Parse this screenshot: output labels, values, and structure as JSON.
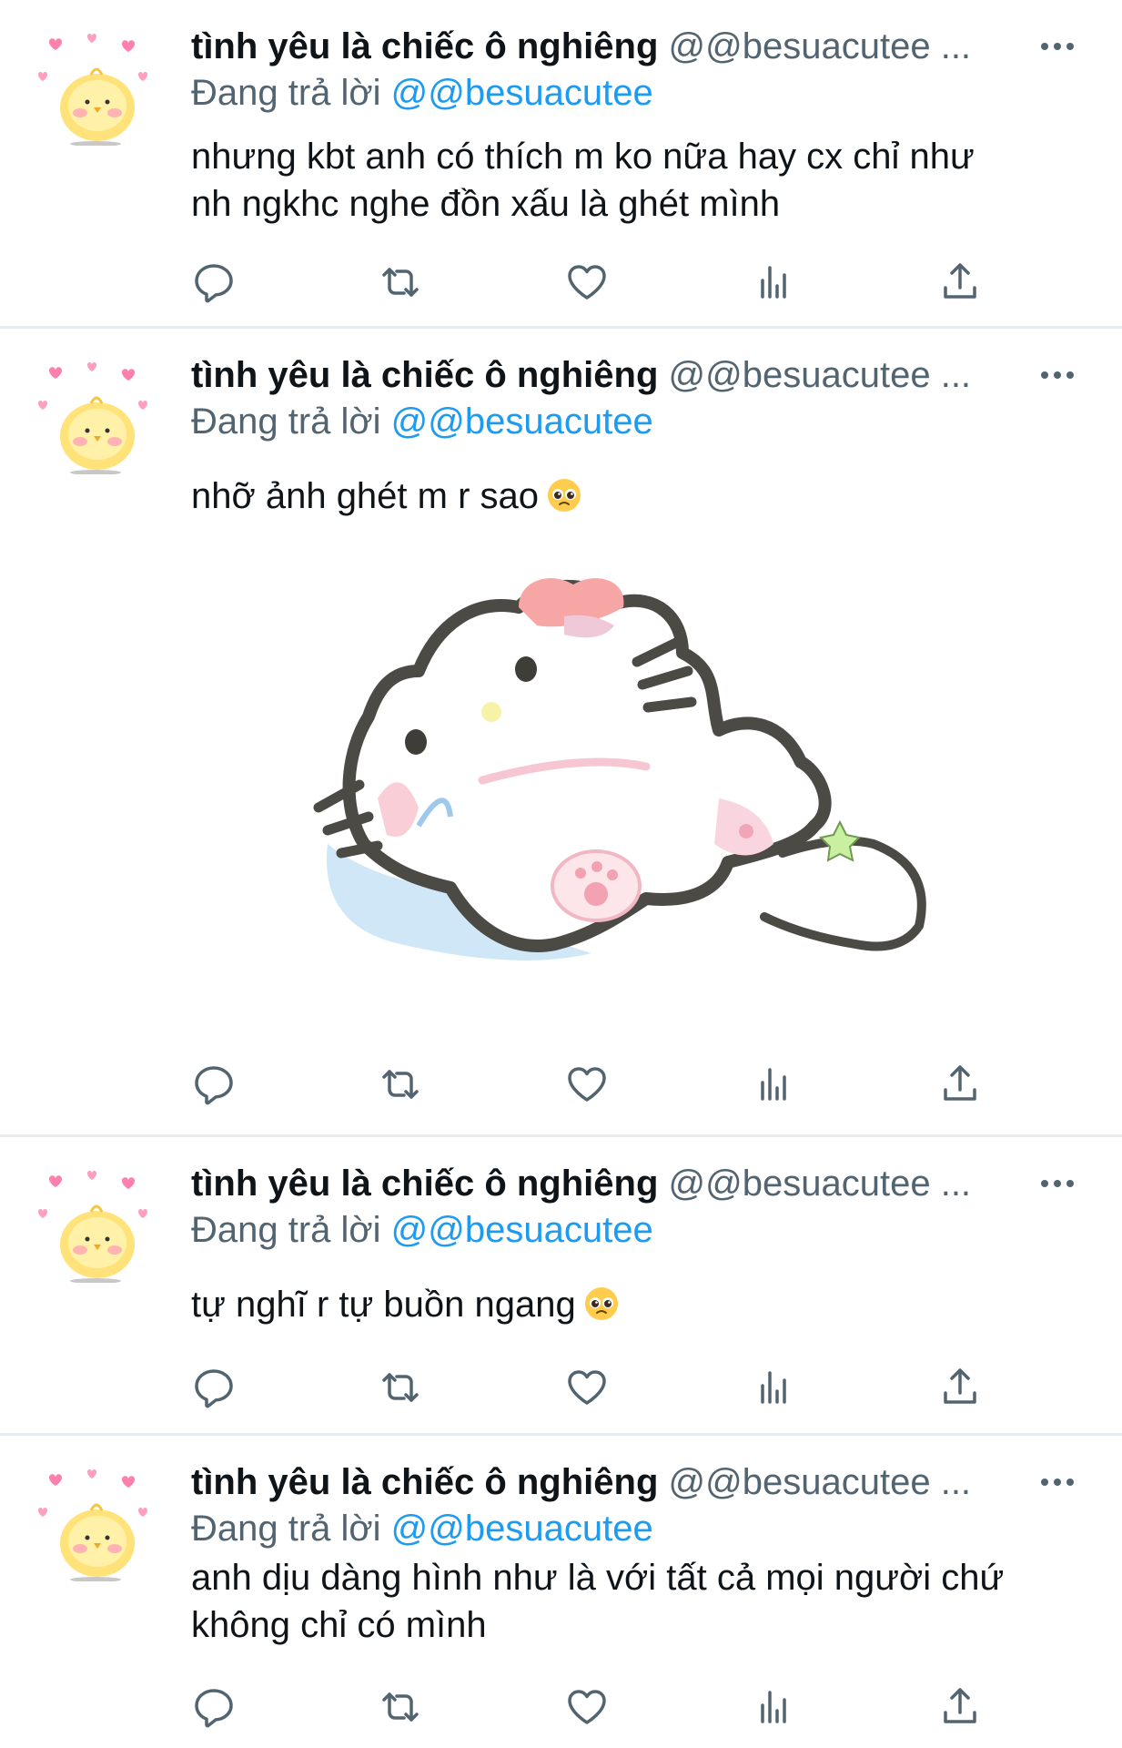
{
  "tweets": [
    {
      "name": "tình yêu là chiếc ô nghiêng",
      "handle": "@@besuacutee",
      "ellipsis": "...",
      "reply_label": "Đang trả lời",
      "reply_to": "@@besuacutee",
      "text_lines": [
        "nhưng kbt anh có thích m ko nữa hay cx chỉ như",
        "nh ngkhc nghe đồn xấu là ghét mình"
      ]
    },
    {
      "name": "tình yêu là chiếc ô nghiêng",
      "handle": "@@besuacutee",
      "ellipsis": "...",
      "reply_label": "Đang trả lời",
      "reply_to": "@@besuacutee",
      "text_lines": [
        "nhỡ ảnh ghét m r sao"
      ],
      "emoji": "pleading-face",
      "media": "hello-kitty-lying-crying-drawing"
    },
    {
      "name": "tình yêu là chiếc ô nghiêng",
      "handle": "@@besuacutee",
      "ellipsis": "...",
      "reply_label": "Đang trả lời",
      "reply_to": "@@besuacutee",
      "text_lines": [
        "tự nghĩ r tự buồn ngang"
      ],
      "emoji": "pleading-face"
    },
    {
      "name": "tình yêu là chiếc ô nghiêng",
      "handle": "@@besuacutee",
      "ellipsis": "...",
      "reply_label": "Đang trả lời",
      "reply_to": "@@besuacutee",
      "text_lines": [
        "anh dịu dàng hình như là với tất cả mọi người chứ",
        "không chỉ có mình"
      ]
    }
  ],
  "icons": {
    "avatar": "chick-with-hearts-avatar",
    "more": "more-options-icon",
    "actions": [
      "reply-icon",
      "retweet-icon",
      "like-icon",
      "views-icon",
      "share-icon"
    ]
  },
  "colors": {
    "mention": "#1d9bf0",
    "secondary_text": "#536471",
    "divider": "#e9ecef"
  }
}
